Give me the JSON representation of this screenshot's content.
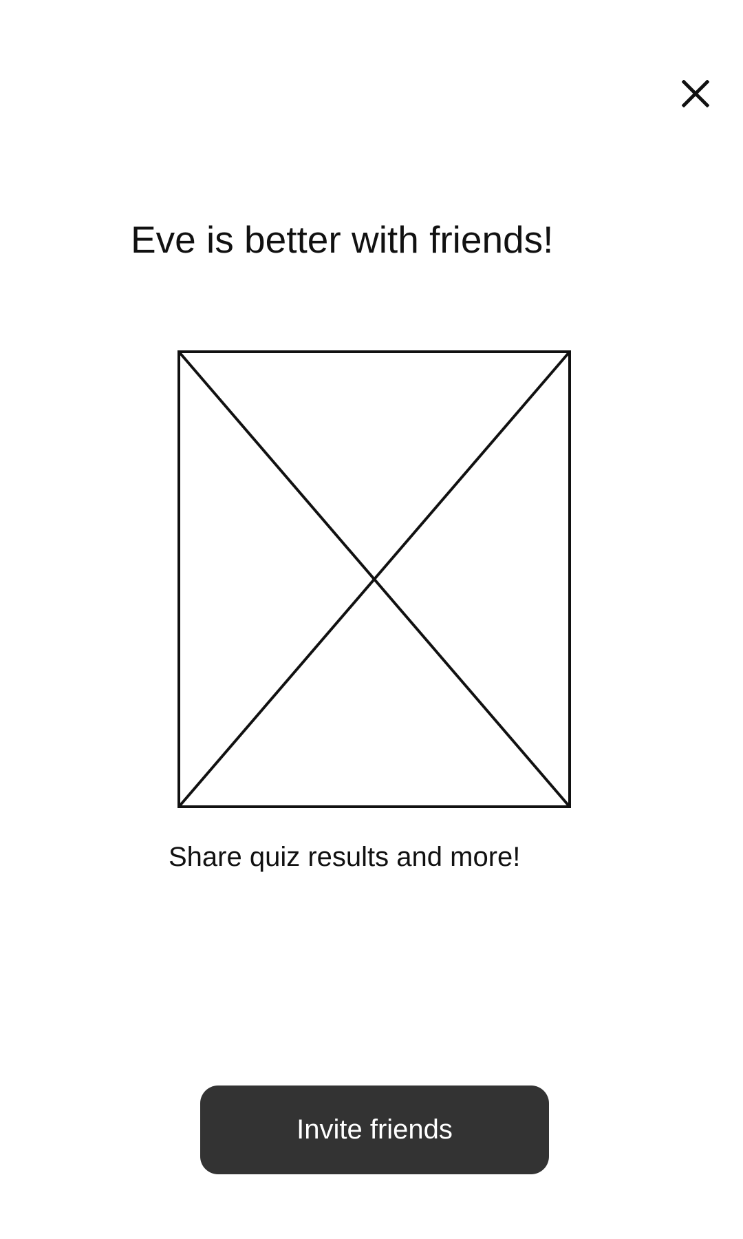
{
  "header": {
    "close_icon": "close-icon"
  },
  "main": {
    "title": "Eve is better with friends!",
    "image_icon": "image-placeholder-icon",
    "subtitle": "Share quiz results and more!"
  },
  "footer": {
    "invite_button_label": "Invite friends"
  },
  "colors": {
    "background": "#ffffff",
    "text": "#111111",
    "button_background": "#333333",
    "button_text": "#ffffff"
  }
}
